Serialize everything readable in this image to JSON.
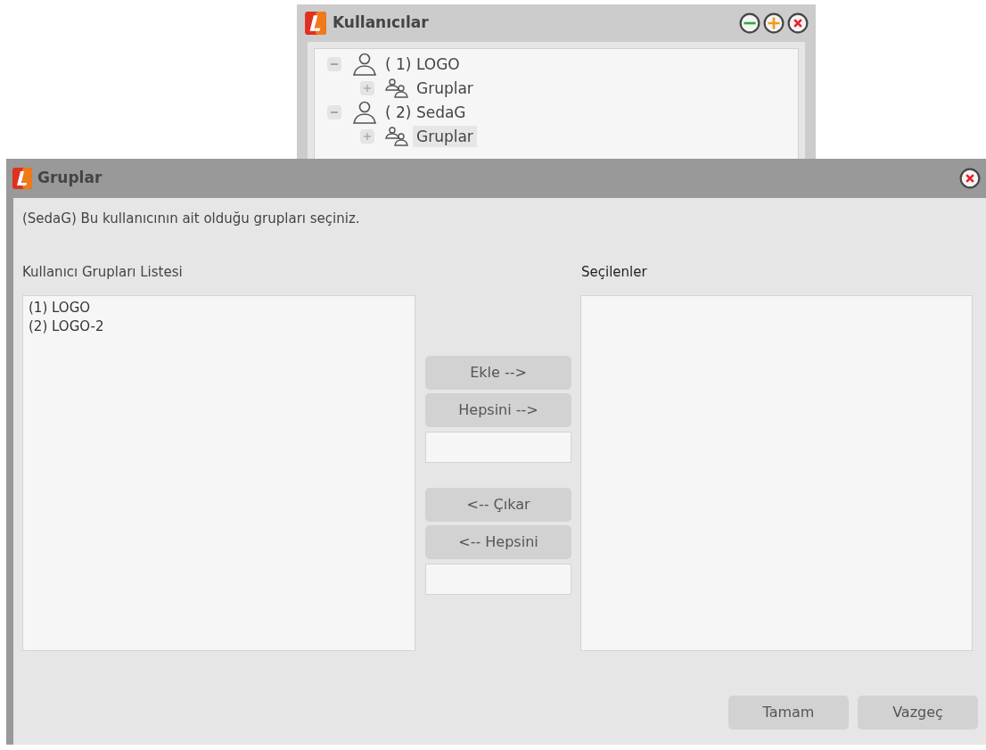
{
  "back_window": {
    "title": "Kullanıcılar",
    "title_buttons": [
      {
        "kind": "minimize"
      },
      {
        "kind": "add"
      },
      {
        "kind": "close"
      }
    ],
    "tree": [
      {
        "label": "( 1) LOGO",
        "kind": "user",
        "expanded": true,
        "selected": false,
        "children": [
          {
            "label": "Gruplar",
            "kind": "group",
            "expanded": false,
            "selected": false
          }
        ]
      },
      {
        "label": "( 2) SedaG",
        "kind": "user",
        "expanded": true,
        "selected": false,
        "children": [
          {
            "label": "Gruplar",
            "kind": "group",
            "expanded": false,
            "selected": true
          }
        ]
      }
    ]
  },
  "dialog": {
    "title": "Gruplar",
    "instruction": "(SedaG) Bu kullanıcının ait olduğu grupları seçiniz.",
    "available": {
      "label": "Kullanıcı Grupları Listesi",
      "items": [
        "(1) LOGO",
        "(2) LOGO-2"
      ]
    },
    "selected_list": {
      "label": "Seçilenler"
    },
    "add_buttons": [
      "Ekle -->",
      "Hepsini -->"
    ],
    "remove_buttons": [
      "<-- Çıkar",
      "<-- Hepsini"
    ],
    "footer_buttons": [
      "Tamam",
      "Vazgeç"
    ]
  }
}
